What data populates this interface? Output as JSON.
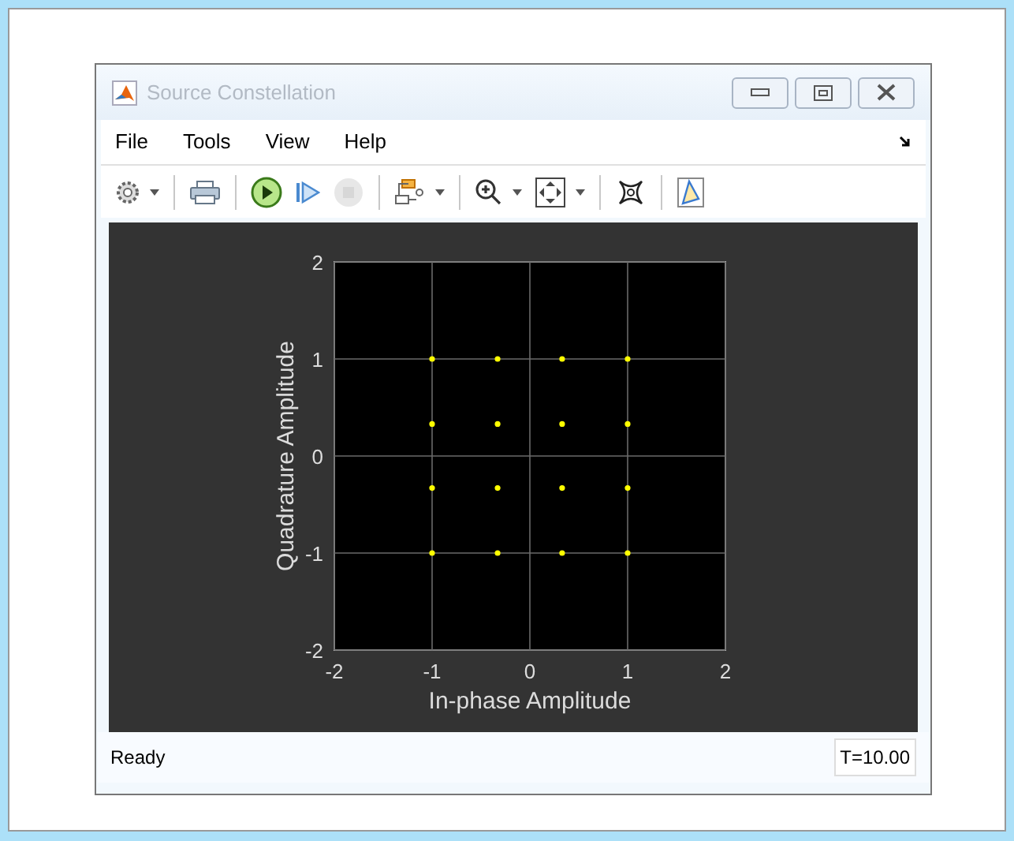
{
  "window": {
    "title": "Source Constellation"
  },
  "menu": [
    {
      "label": "File"
    },
    {
      "label": "Tools"
    },
    {
      "label": "View"
    },
    {
      "label": "Help"
    }
  ],
  "toolbar": [
    {
      "kind": "settings",
      "dropdown": true,
      "disabled": false
    },
    {
      "kind": "print",
      "dropdown": false,
      "disabled": false
    },
    {
      "kind": "run",
      "dropdown": false,
      "disabled": false
    },
    {
      "kind": "step",
      "dropdown": false,
      "disabled": false
    },
    {
      "kind": "stop",
      "dropdown": false,
      "disabled": true
    },
    {
      "kind": "hierarchy",
      "dropdown": true,
      "disabled": false
    },
    {
      "kind": "zoom",
      "dropdown": true,
      "disabled": false
    },
    {
      "kind": "fit",
      "dropdown": true,
      "disabled": false
    },
    {
      "kind": "scatter",
      "dropdown": false,
      "disabled": false
    },
    {
      "kind": "cursor",
      "dropdown": false,
      "disabled": false
    }
  ],
  "plot": {
    "chart_data": {
      "type": "scatter",
      "xlabel": "In-phase Amplitude",
      "ylabel": "Quadrature Amplitude",
      "x": [
        -1,
        -1,
        -1,
        -1,
        -0.33,
        -0.33,
        -0.33,
        -0.33,
        0.33,
        0.33,
        0.33,
        0.33,
        1,
        1,
        1,
        1
      ],
      "series": [
        {
          "color": "#ffff00",
          "values": [
            1,
            0.33,
            -0.33,
            -1,
            1,
            0.33,
            -0.33,
            -1,
            1,
            0.33,
            -0.33,
            -1,
            1,
            0.33,
            -0.33,
            -1
          ]
        }
      ],
      "grid": true,
      "xlim": [
        -2,
        2
      ],
      "ylim": [
        -2,
        2
      ],
      "xticks": [
        -2,
        -1,
        0,
        1,
        2
      ],
      "yticks": [
        -2,
        -1,
        0,
        1,
        2
      ]
    }
  },
  "status_bar": {
    "text": "Ready",
    "time": "T=10.00"
  }
}
